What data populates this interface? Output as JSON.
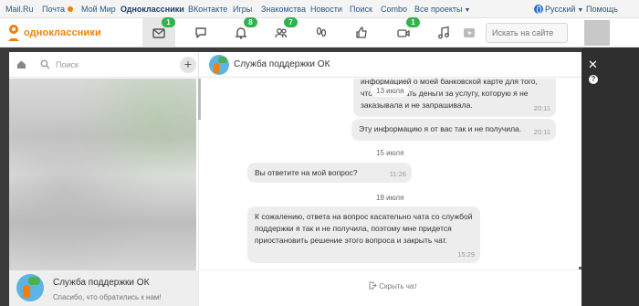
{
  "topbar": {
    "links": [
      "Mail.Ru",
      "Почта",
      "Мой Мир",
      "Одноклассники",
      "ВКонтакте",
      "Игры",
      "Знакомства",
      "Новости",
      "Поиск",
      "Combo",
      "Все проекты"
    ],
    "language": "Русский",
    "help": "Помощь"
  },
  "header": {
    "logo_text": "одноклассники",
    "badges": {
      "messages": "1",
      "notifications": "8",
      "friends": "7",
      "video": "1"
    },
    "search_placeholder": "Искать на сайте"
  },
  "sidebar": {
    "search_placeholder": "Поиск",
    "active_chat": {
      "name": "Служба поддержки ОК",
      "preview": "Спасибо, что обратились к нам!"
    }
  },
  "chat": {
    "title": "Служба поддержки ОК",
    "hide_chat": "Скрыть чат",
    "messages": [
      {
        "text": "информацией о моей банковской карте для того, чтоб списывать деньги за услугу, которую я не заказывала и не запрашивала.",
        "time": "20:11",
        "date_overlay": "13 июля"
      },
      {
        "text": "Эту информацию я от вас так и не получила.",
        "time": "20:11"
      },
      {
        "date": "15 июля"
      },
      {
        "text": "Вы ответите на мой вопрос?",
        "time": "11:26"
      },
      {
        "date": "18 июля"
      },
      {
        "text": "К сожалению, ответа на вопрос касательно чата со службой поддержки я так и не получила, поэтому мне придется приостановить решение этого вопроса и закрыть чат.",
        "time": "15:29"
      }
    ]
  },
  "overlay": {
    "close": "✕",
    "help": "?"
  }
}
